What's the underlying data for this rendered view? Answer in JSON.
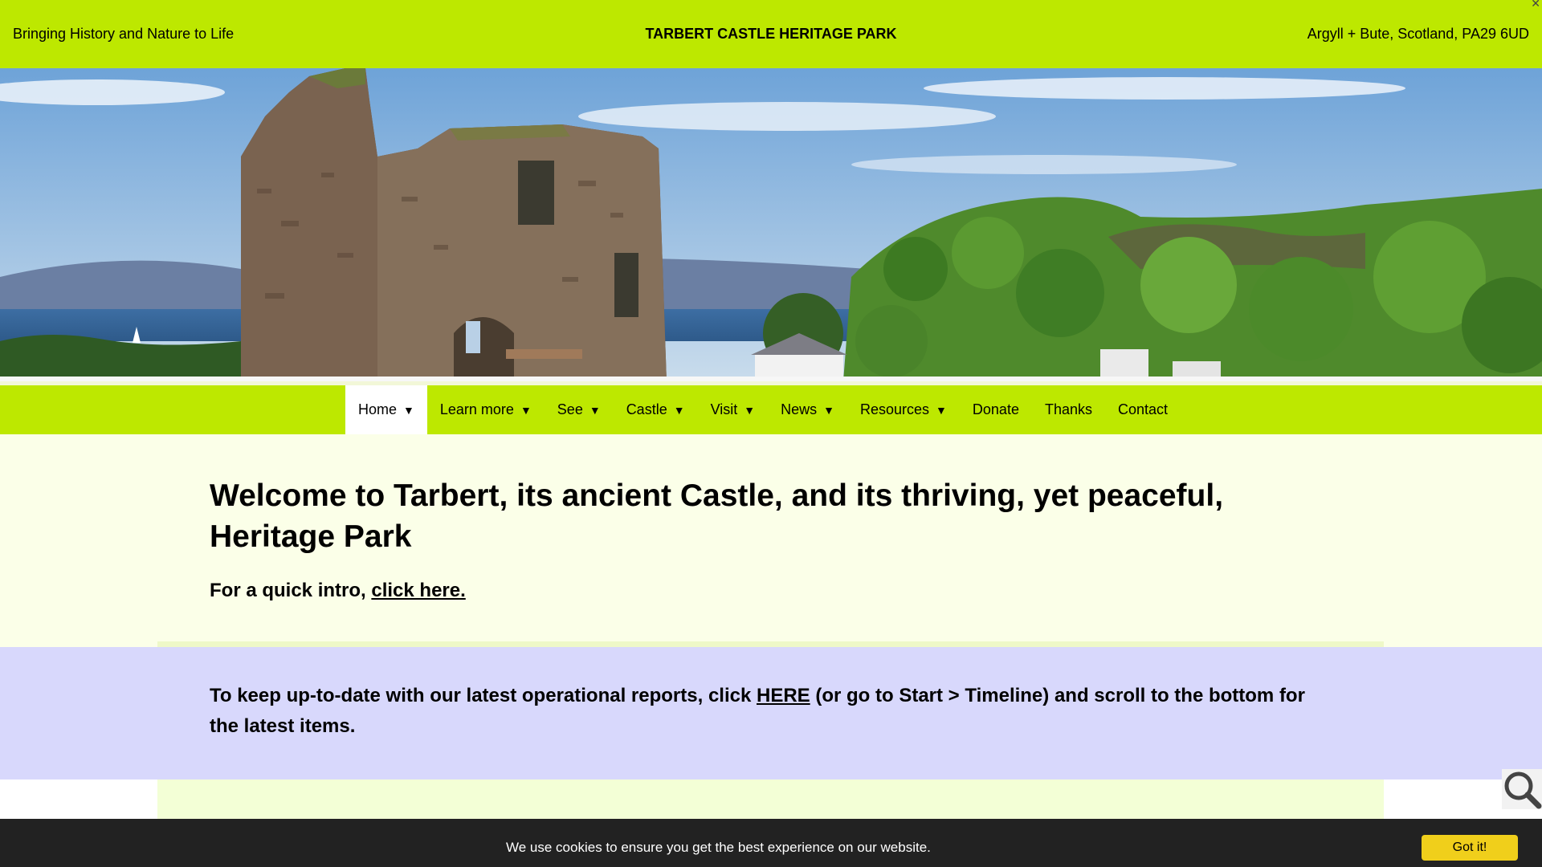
{
  "header": {
    "tagline": "Bringing History and Nature to Life",
    "title": "TARBERT CASTLE HERITAGE PARK",
    "address": "Argyll + Bute, Scotland, PA29 6UD",
    "close_glyph": "✕"
  },
  "nav": {
    "items": [
      {
        "label": "Home",
        "caret": "▼"
      },
      {
        "label": "Learn more",
        "caret": "▼"
      },
      {
        "label": "See",
        "caret": "▼"
      },
      {
        "label": "Castle",
        "caret": "▼"
      },
      {
        "label": "Visit",
        "caret": "▼"
      },
      {
        "label": "News",
        "caret": "▼"
      },
      {
        "label": "Resources",
        "caret": "▼"
      },
      {
        "label": "Donate"
      },
      {
        "label": "Thanks"
      },
      {
        "label": "Contact"
      }
    ],
    "active": "Home"
  },
  "intro": {
    "heading": "Welcome to Tarbert, its ancient Castle, and its thriving, yet peaceful, Heritage Park",
    "quick_intro_prefix": "For a quick intro, ",
    "quick_intro_link": "click here."
  },
  "updates": {
    "text_before": "To keep up-to-date with our latest operational reports, click ",
    "link": "HERE",
    "text_after": " (or go to Start > Timeline) and scroll to the bottom for the latest items."
  },
  "cookie": {
    "message": "We use cookies to ensure you get the best experience on our website.",
    "button": "Got it!"
  },
  "colors": {
    "brand_green": "#bde800",
    "intro_bg": "#fbffe8",
    "update_bg": "#d8d8fc",
    "cookie_bg": "#222222",
    "cookie_button": "#f0cf1b"
  },
  "icons": {
    "search": "search-icon",
    "close": "close-icon"
  }
}
